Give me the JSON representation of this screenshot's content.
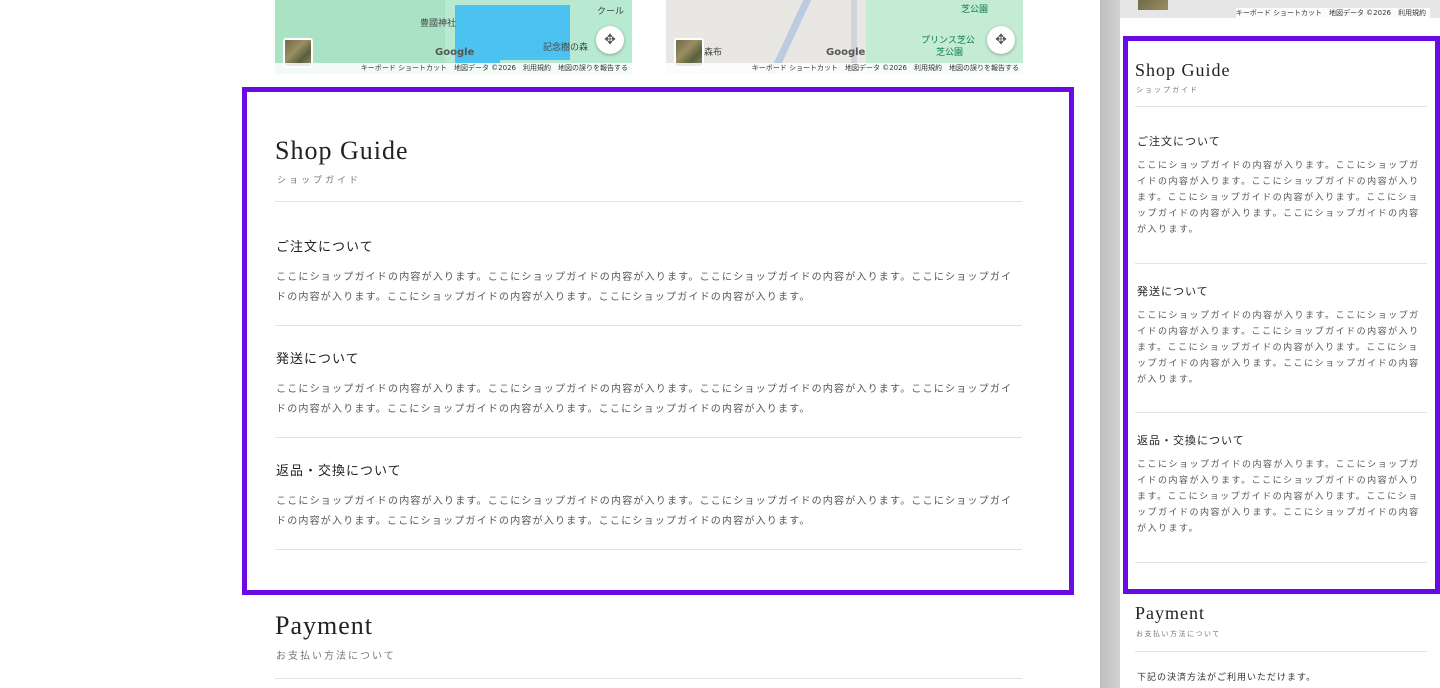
{
  "maps": {
    "left": {
      "labels": [
        "豊國神社",
        "記念樹の森",
        "クール"
      ],
      "google": "Google",
      "attribution": "キーボード ショートカット　地図データ ©2026　利用規約　地図の誤りを報告する"
    },
    "right": {
      "labels": [
        "森布",
        "プリンス芝公",
        "芝公園",
        "芝公園"
      ],
      "google": "Google",
      "attribution": "キーボード ショートカット　地図データ ©2026　利用規約　地図の誤りを報告する"
    },
    "mobile_attribution": "キーボード ショートカット　地図データ ©2026　利用規約"
  },
  "shop_guide": {
    "title": "Shop Guide",
    "subtitle": "ショップガイド",
    "items": [
      {
        "heading": "ご注文について",
        "body": "ここにショップガイドの内容が入ります。ここにショップガイドの内容が入ります。ここにショップガイドの内容が入ります。ここにショップガイドの内容が入ります。ここにショップガイドの内容が入ります。ここにショップガイドの内容が入ります。"
      },
      {
        "heading": "発送について",
        "body": "ここにショップガイドの内容が入ります。ここにショップガイドの内容が入ります。ここにショップガイドの内容が入ります。ここにショップガイドの内容が入ります。ここにショップガイドの内容が入ります。ここにショップガイドの内容が入ります。"
      },
      {
        "heading": "返品・交換について",
        "body": "ここにショップガイドの内容が入ります。ここにショップガイドの内容が入ります。ここにショップガイドの内容が入ります。ここにショップガイドの内容が入ります。ここにショップガイドの内容が入ります。ここにショップガイドの内容が入ります。"
      }
    ]
  },
  "payment": {
    "title": "Payment",
    "subtitle": "お支払い方法について",
    "intro": "下記の決済方法がご利用いただけます。"
  },
  "colors": {
    "highlight": "#6a0be3",
    "map_water": "#4cc2f0",
    "map_green": "#a8e6c2"
  }
}
